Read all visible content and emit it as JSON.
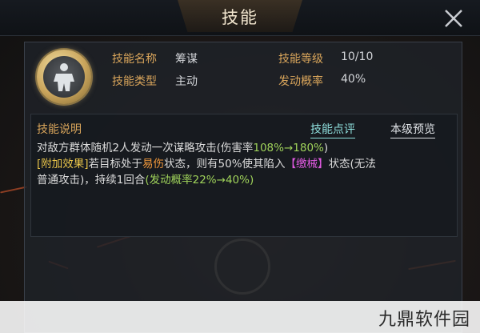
{
  "header": {
    "title": "技能"
  },
  "skill": {
    "name_label": "技能名称",
    "name_value": "筹谋",
    "level_label": "技能等级",
    "level_value": "10/10",
    "type_label": "技能类型",
    "type_value": "主动",
    "rate_label": "发动概率",
    "rate_value": "40%",
    "icon": "soldier-emblem-icon"
  },
  "description": {
    "title": "技能说明",
    "eval_link": "技能点评",
    "preview_link": "本级预览",
    "line1_a": "对敌方群体随机2人发动一次谋略攻击(伤害率",
    "line1_b": "108%→180%",
    "line1_c": ")",
    "line2_a": "[附加效果]",
    "line2_b": "若目标处于",
    "line2_c": "易伤",
    "line2_d": "状态，则有50%使其陷入",
    "line2_e": "【缴械】",
    "line2_f": "状态(无法",
    "line3_a": "普通攻击)，持续1回合",
    "line3_b": "(发动概率22%→40%)"
  },
  "watermark": {
    "text": "九鼎软件园"
  },
  "colors": {
    "label": "#d9a55b",
    "highlight_yellow": "#e8c44a",
    "highlight_green": "#9fd25a",
    "highlight_orange": "#f0973a",
    "highlight_magenta": "#e05ae0",
    "link_cyan": "#8fe0de"
  }
}
